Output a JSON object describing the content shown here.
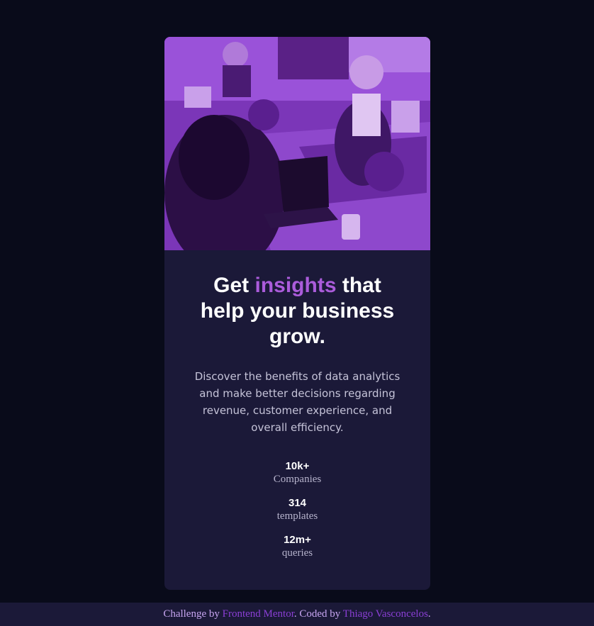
{
  "hero_image": {
    "alt": "",
    "tint": "#8a3ccf"
  },
  "headline": {
    "part1": "Get ",
    "accent": "insights",
    "part2": " that help your business grow."
  },
  "description": "Discover the benefits of data analytics and make better decisions regarding revenue, customer experience, and overall efficiency.",
  "stats": [
    {
      "value": "10k+",
      "label": "Companies"
    },
    {
      "value": "314",
      "label": "templates"
    },
    {
      "value": "12m+",
      "label": "queries"
    }
  ],
  "footer": {
    "prefix": "Challenge by ",
    "link1": "Frontend Mentor",
    "middle": ". Coded by ",
    "link2": "Thiago Vasconcelos",
    "suffix": "."
  },
  "colors": {
    "page_bg": "#090b1a",
    "card_bg": "#1b1938",
    "accent": "#ab5cdb",
    "text": "#ffffff"
  }
}
